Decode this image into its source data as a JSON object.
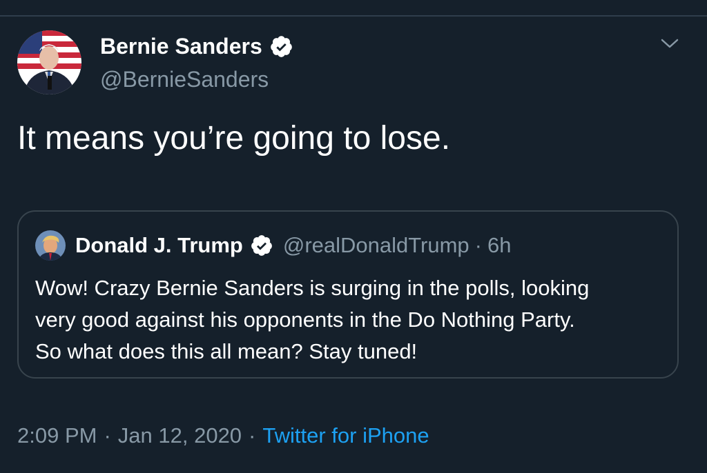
{
  "tweet": {
    "author_name": "Bernie Sanders",
    "author_handle": "@BernieSanders",
    "text": "It means you’re going to lose.",
    "time": "2:09 PM",
    "separator": "·",
    "date": "Jan 12, 2020",
    "source": "Twitter for iPhone"
  },
  "quoted": {
    "author_name": "Donald J. Trump",
    "author_handle": "@realDonaldTrump",
    "separator": "·",
    "time_ago": "6h",
    "lines": [
      "Wow! Crazy Bernie Sanders is surging in the polls, looking",
      "very good against his opponents in the Do Nothing Party.",
      "So what does this all mean? Stay tuned!"
    ]
  },
  "icons": {
    "verified": "verified-badge-icon",
    "menu": "chevron-down-icon"
  },
  "colors": {
    "background": "#15202b",
    "secondary_text": "#8899a6",
    "link": "#1da1f2",
    "border": "#38444d"
  }
}
